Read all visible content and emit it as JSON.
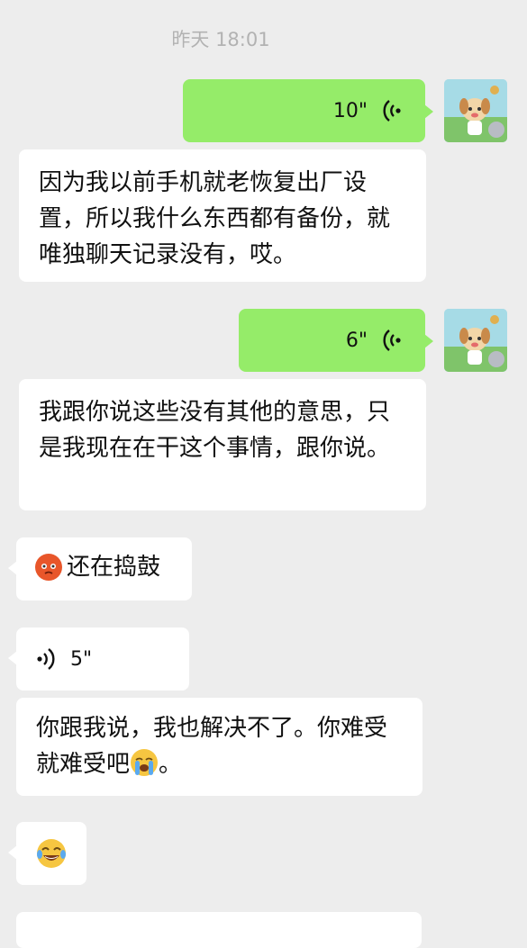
{
  "timestamp": "昨天 18:01",
  "messages": {
    "m1": {
      "duration": "10\""
    },
    "m2": {
      "text": "因为我以前手机就老恢复出厂设置，所以我什么东西都有备份，就唯独聊天记录没有，哎。"
    },
    "m3": {
      "duration": "6\""
    },
    "m4": {
      "text": "我跟你说这些没有其他的意思，只是我现在在干这个事情，跟你说。"
    },
    "m5": {
      "text": "还在捣鼓",
      "emoji": "angry-face-emoji"
    },
    "m6": {
      "duration": "5\""
    },
    "m7": {
      "text_before": "你跟我说，我也解决不了。你难受就难受吧",
      "text_after": "。",
      "emoji": "crying-face-emoji"
    },
    "m8": {
      "emoji": "tears-of-joy-emoji"
    }
  },
  "colors": {
    "background": "#ededed",
    "outgoing_bubble": "#95ec69",
    "incoming_bubble": "#ffffff",
    "timestamp": "#b2b2b2"
  }
}
